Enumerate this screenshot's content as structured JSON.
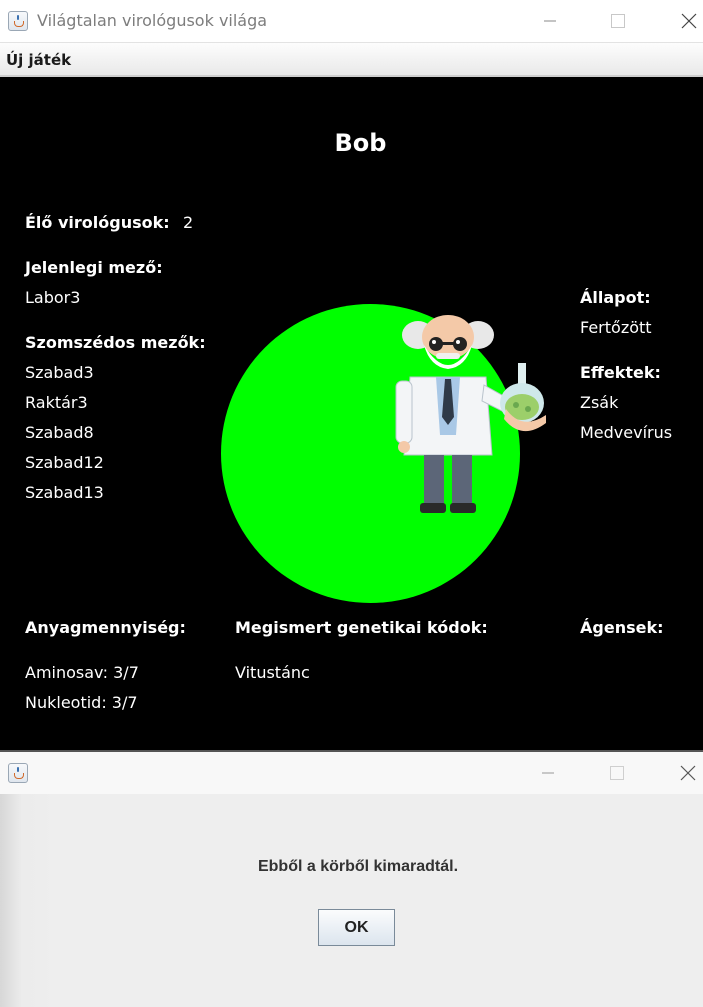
{
  "window": {
    "title": "Világtalan virológusok világa",
    "icon": "java-coffee-icon"
  },
  "menubar": {
    "items": [
      {
        "label": "Új játék"
      }
    ]
  },
  "game": {
    "player_name": "Bob",
    "alive_label": "Élő virológusok:",
    "alive_count": "2",
    "current_field_label": "Jelenlegi mező:",
    "current_field": "Labor3",
    "neighbors_label": "Szomszédos mezők:",
    "neighbors": [
      "Szabad3",
      "Raktár3",
      "Szabad8",
      "Szabad12",
      "Szabad13"
    ],
    "state_label": "Állapot:",
    "state": "Fertőzött",
    "effects_label": "Effektek:",
    "effects": [
      "Zsák",
      "Medvevírus"
    ],
    "materials_label": "Anyagmennyiség:",
    "materials": [
      "Aminosav: 3/7",
      "Nukleotid: 3/7"
    ],
    "codes_label": "Megismert genetikai kódok:",
    "codes": [
      "Vitustánc"
    ],
    "agents_label": "Ágensek:",
    "field_color": "#00ff00",
    "avatar": "scientist-avatar"
  },
  "dialog": {
    "title": "",
    "message": "Ebből a körből kimaradtál.",
    "ok_label": "OK"
  },
  "colors": {
    "background": "#000000",
    "text": "#ffffff",
    "field_circle": "#00ff00"
  }
}
